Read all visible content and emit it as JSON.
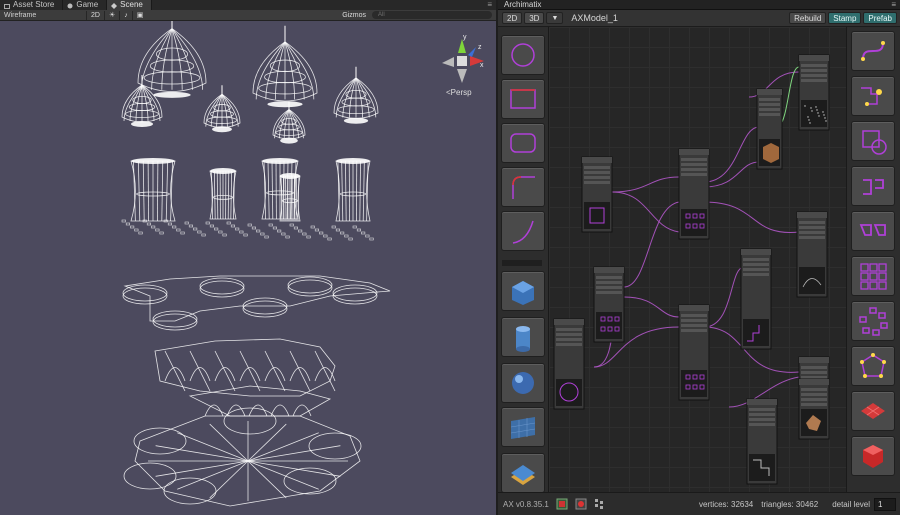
{
  "scene": {
    "tabs": [
      {
        "label": "Asset Store",
        "icon": "store-icon"
      },
      {
        "label": "Game",
        "icon": "game-icon"
      },
      {
        "label": "Scene",
        "icon": "scene-icon"
      }
    ],
    "shading_mode": "Wireframe",
    "mode_2d": "2D",
    "gizmos_label": "Gizmos",
    "search_placeholder": "All",
    "persp_label": "Persp",
    "gizmo_axes": {
      "y": "y",
      "x": "x",
      "z": "z"
    },
    "viewport_color": "#4c4a5e"
  },
  "editor": {
    "title": "Archimatix",
    "mode_buttons": [
      "2D",
      "3D"
    ],
    "model_name": "AXModel_1",
    "rebuild_label": "Rebuild",
    "stamp_label": "Stamp",
    "prefab_label": "Prefab",
    "accent_color": "#b040d8",
    "left_tools": [
      "circle-shape-icon",
      "rectangle-shape-icon",
      "rounded-rect-icon",
      "fillet-curve-icon",
      "arc-curve-icon",
      "box-mesh-icon",
      "cylinder-mesh-icon",
      "sphere-mesh-icon",
      "plane-mesh-icon",
      "stairs-mesh-icon"
    ],
    "right_tools": [
      "bezier-icon",
      "shape-merger-icon",
      "shape-offset-icon",
      "corner-shape-icon",
      "pair-repeater-icon",
      "grid-repeater-icon",
      "radial-repeater-icon",
      "polygon-icon",
      "floor-tile-icon",
      "cube-red-icon"
    ],
    "status": {
      "version": "AX v0.8.35.1",
      "vertices_label": "vertices: 32634",
      "triangles_label": "triangles: 30462",
      "detail_label": "detail level",
      "detail_value": "1"
    }
  }
}
